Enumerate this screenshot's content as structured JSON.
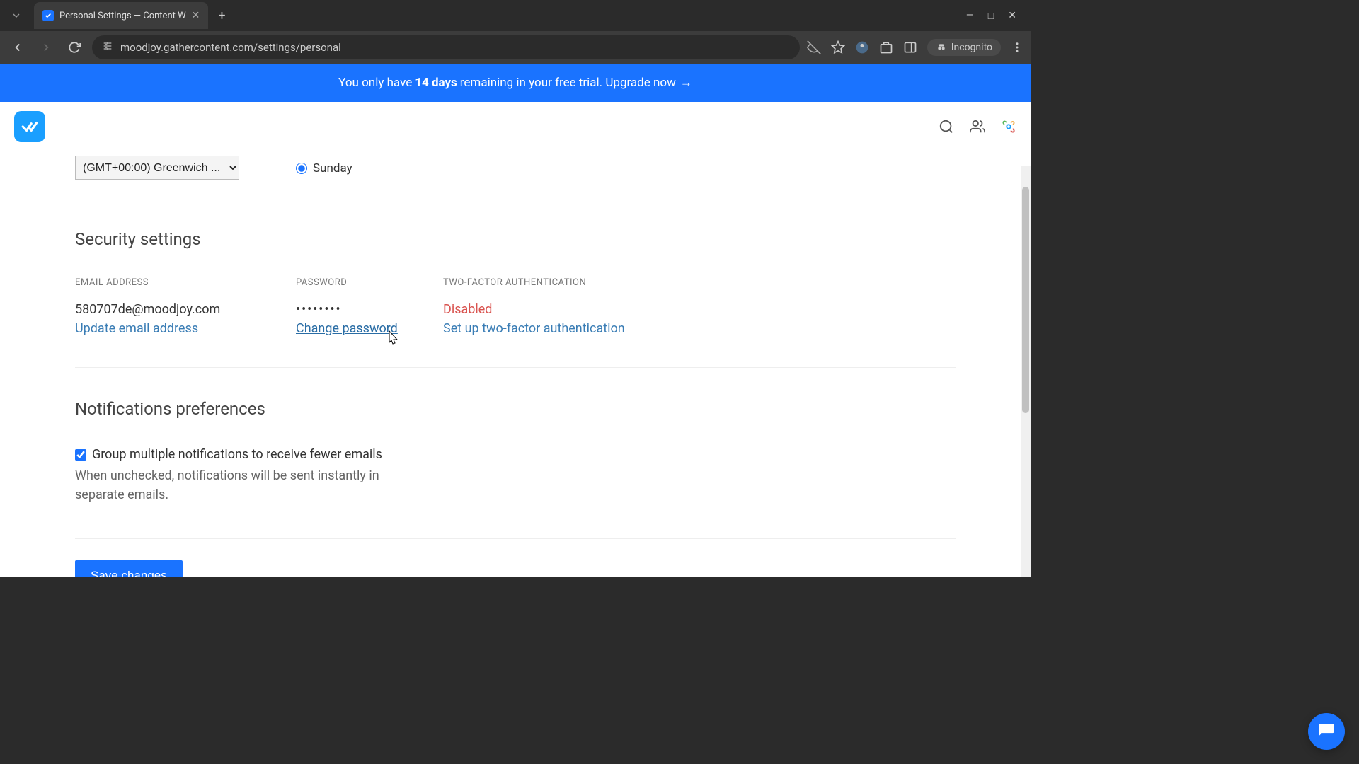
{
  "browser": {
    "tab_title": "Personal Settings — Content W",
    "url": "moodjoy.gathercontent.com/settings/personal",
    "incognito_label": "Incognito"
  },
  "banner": {
    "prefix": "You only have",
    "days": "14 days",
    "suffix": "remaining in your free trial. Upgrade now",
    "arrow": "→"
  },
  "timezone": {
    "selected": "(GMT+00:00) Greenwich ...",
    "day_option": "Sunday"
  },
  "security": {
    "heading": "Security settings",
    "email_label": "EMAIL ADDRESS",
    "email_value": "580707de@moodjoy.com",
    "email_action": "Update email address",
    "password_label": "PASSWORD",
    "password_value": "••••••••",
    "password_action": "Change password",
    "tfa_label": "TWO-FACTOR AUTHENTICATION",
    "tfa_value": "Disabled",
    "tfa_action": "Set up two-factor authentication"
  },
  "notifications": {
    "heading": "Notifications preferences",
    "checkbox_label": "Group multiple notifications to receive fewer emails",
    "help_text": "When unchecked, notifications will be sent instantly in separate emails."
  },
  "save_label": "Save changes"
}
